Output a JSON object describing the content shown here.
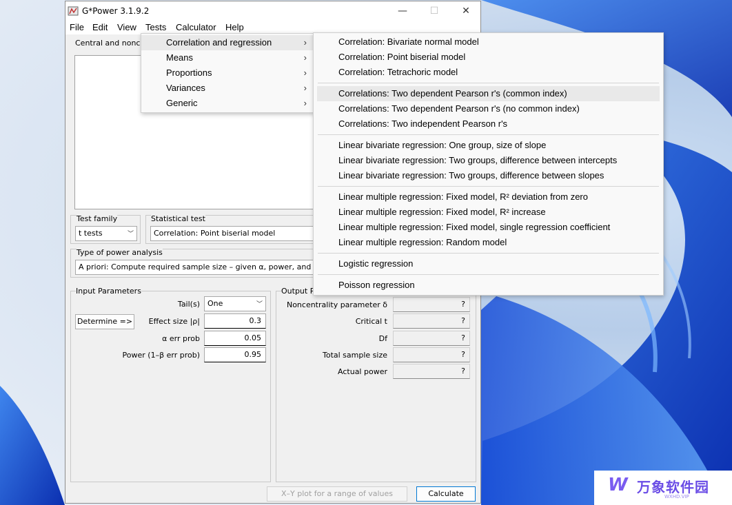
{
  "window": {
    "title": "G*Power 3.1.9.2",
    "controls": {
      "minimize": "—",
      "maximize": "☐",
      "close": "✕"
    }
  },
  "menubar": [
    {
      "label": "File"
    },
    {
      "label": "Edit"
    },
    {
      "label": "View"
    },
    {
      "label": "Tests"
    },
    {
      "label": "Calculator"
    },
    {
      "label": "Help"
    }
  ],
  "central": {
    "label": "Central and nonce"
  },
  "test_family": {
    "label": "Test family",
    "value": "t tests"
  },
  "statistical_test": {
    "label": "Statistical test",
    "value": "Correlation: Point biserial model"
  },
  "power_analysis": {
    "label": "Type of power analysis",
    "value": "A priori: Compute required sample size – given α, power, and ef"
  },
  "input": {
    "label": "Input Parameters",
    "tails_label": "Tail(s)",
    "tails_value": "One",
    "determine_label": "Determine =>",
    "effect_label": "Effect size |ρ|",
    "effect_value": "0.3",
    "alpha_label": "α err prob",
    "alpha_value": "0.05",
    "power_label": "Power (1–β err prob)",
    "power_value": "0.95"
  },
  "output": {
    "label": "Output P",
    "rows": [
      {
        "label": "Noncentrality parameter δ",
        "value": "?"
      },
      {
        "label": "Critical t",
        "value": "?"
      },
      {
        "label": "Df",
        "value": "?"
      },
      {
        "label": "Total sample size",
        "value": "?"
      },
      {
        "label": "Actual power",
        "value": "?"
      }
    ]
  },
  "bottom": {
    "xy_plot": "X–Y plot for a range of values",
    "calculate": "Calculate"
  },
  "tests_menu": [
    {
      "label": "Correlation and regression"
    },
    {
      "label": "Means"
    },
    {
      "label": "Proportions"
    },
    {
      "label": "Variances"
    },
    {
      "label": "Generic"
    }
  ],
  "submenu": [
    "Correlation: Bivariate normal model",
    "Correlation: Point biserial model",
    "Correlation: Tetrachoric model",
    "Correlations: Two dependent Pearson r's (common index)",
    "Correlations: Two dependent Pearson r's (no common index)",
    "Correlations: Two independent Pearson r's",
    "Linear bivariate regression: One group, size of slope",
    "Linear bivariate regression: Two groups, difference between intercepts",
    "Linear bivariate regression: Two groups, difference between slopes",
    "Linear multiple regression: Fixed model, R² deviation from zero",
    "Linear multiple regression: Fixed model, R² increase",
    "Linear multiple regression: Fixed model, single regression coefficient",
    "Linear multiple regression: Random model",
    "Logistic regression",
    "Poisson regression"
  ],
  "icons": {
    "chevron_right": "›",
    "combo_arrow": "﹀"
  },
  "watermark": {
    "logo": "W",
    "text": "万象软件园",
    "sub": "WXHD.VIP"
  },
  "colors": {
    "accent": "#0078d4",
    "wallpaper": "#1f56d6"
  }
}
